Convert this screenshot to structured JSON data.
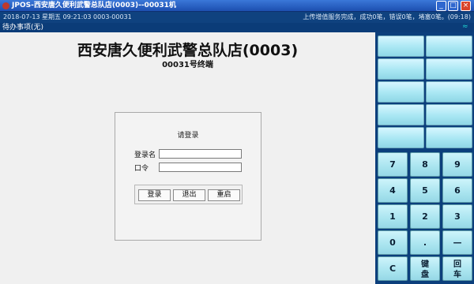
{
  "window": {
    "title": "JPOS-西安唐久便利武警总队店(0003)--00031机",
    "min_label": "_",
    "max_label": "□",
    "close_label": "×"
  },
  "infobar": {
    "left": "2018-07-13 星期五 09:21:03 0003-00031",
    "right": "上传增值服务完成，成功0笔，错误0笔，堵塞0笔。(09:18)"
  },
  "pending": {
    "label": "待办事项(无)"
  },
  "store": {
    "name": "西安唐久便利武警总队店(0003)",
    "terminal": "00031号终端"
  },
  "login": {
    "heading": "请登录",
    "username_label": "登录名",
    "password_label": "口令",
    "username_value": "",
    "password_value": "",
    "buttons": {
      "login": "登录",
      "exit": "退出",
      "restart": "重启"
    }
  },
  "keypad": {
    "rows": [
      [
        "7",
        "8",
        "9"
      ],
      [
        "4",
        "5",
        "6"
      ],
      [
        "1",
        "2",
        "3"
      ],
      [
        "0",
        ".",
        "—"
      ],
      [
        "C",
        "键盘",
        "回车"
      ]
    ]
  },
  "colors": {
    "accent": "#0b3c78",
    "key": "#a9e4ef"
  }
}
